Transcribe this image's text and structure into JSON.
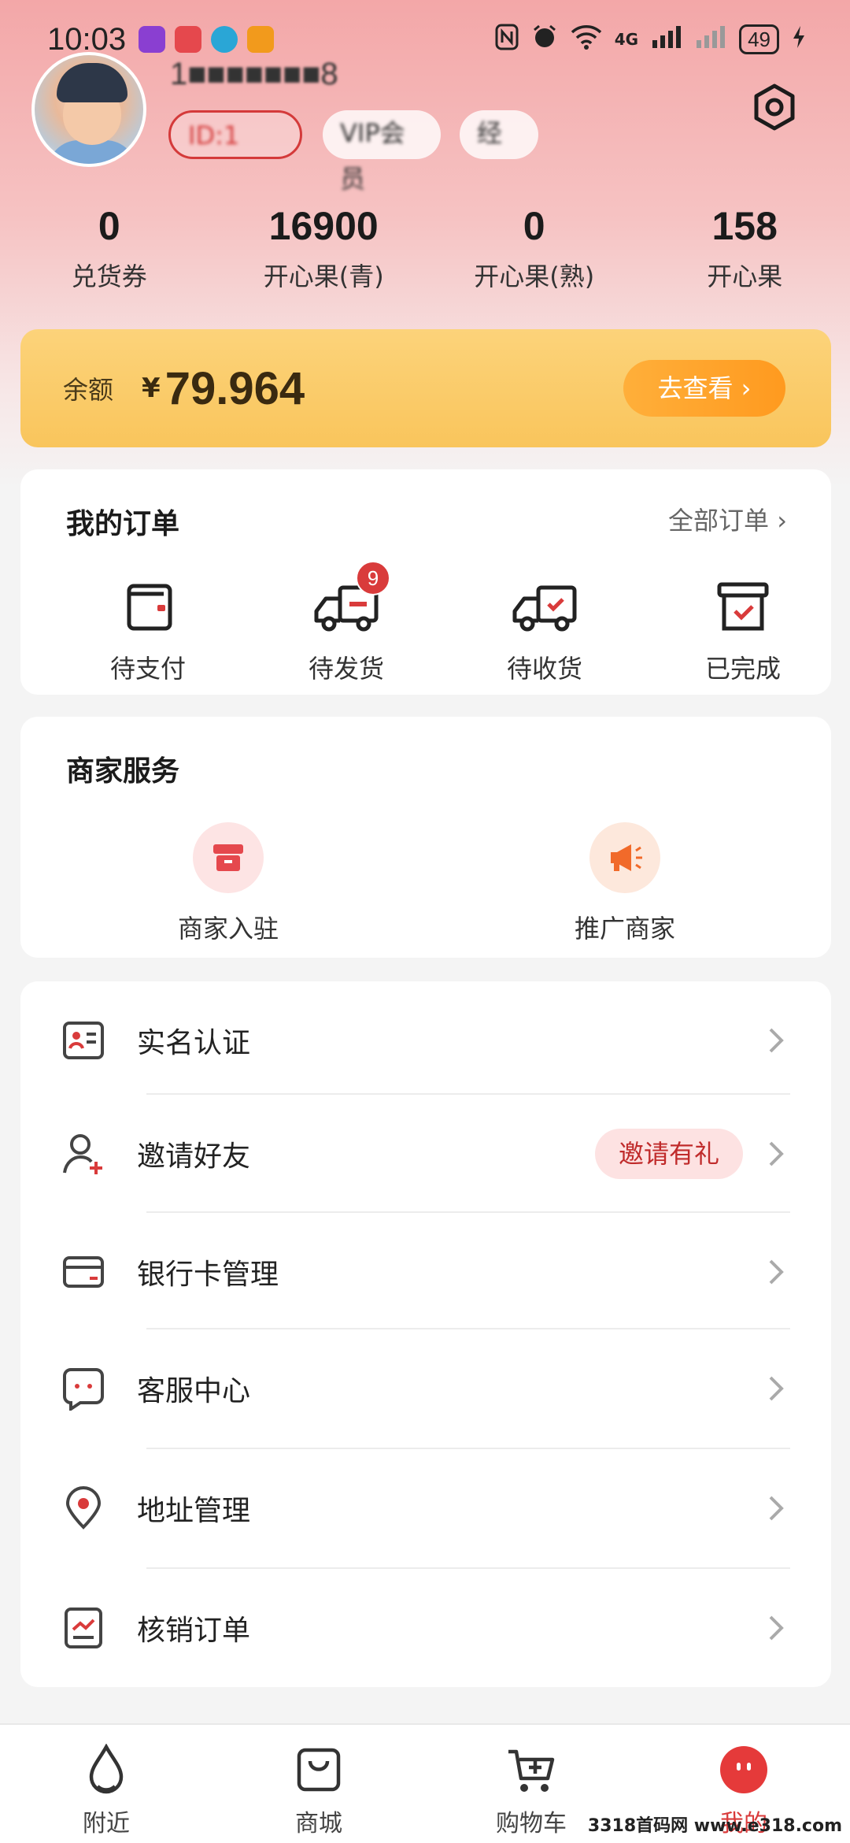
{
  "status_bar": {
    "time": "10:03",
    "network": "4G",
    "battery": "49"
  },
  "profile": {
    "username": "1■■■■■■■8",
    "id_prefix": "ID:1",
    "vip_label": "VIP会员",
    "level_label": "经"
  },
  "stats": [
    {
      "value": "0",
      "label": "兑货券"
    },
    {
      "value": "16900",
      "label": "开心果(青)"
    },
    {
      "value": "0",
      "label": "开心果(熟)"
    },
    {
      "value": "158",
      "label": "开心果"
    }
  ],
  "balance": {
    "label": "余额",
    "currency": "¥",
    "amount": "79.964",
    "button": "去查看 ›"
  },
  "orders": {
    "title": "我的订单",
    "all_link": "全部订单 ›",
    "items": [
      {
        "label": "待支付",
        "icon": "wallet-icon"
      },
      {
        "label": "待发货",
        "icon": "truck-pending-icon",
        "badge": "9"
      },
      {
        "label": "待收货",
        "icon": "truck-check-icon"
      },
      {
        "label": "已完成",
        "icon": "box-check-icon"
      }
    ]
  },
  "merchant": {
    "title": "商家服务",
    "items": [
      {
        "label": "商家入驻",
        "icon": "store-icon"
      },
      {
        "label": "推广商家",
        "icon": "megaphone-icon"
      }
    ]
  },
  "menu": [
    {
      "label": "实名认证",
      "icon": "id-card-icon"
    },
    {
      "label": "邀请好友",
      "icon": "add-user-icon",
      "tag": "邀请有礼"
    },
    {
      "label": "银行卡管理",
      "icon": "bank-card-icon"
    },
    {
      "label": "客服中心",
      "icon": "chat-icon"
    },
    {
      "label": "地址管理",
      "icon": "location-pin-icon"
    },
    {
      "label": "核销订单",
      "icon": "report-icon"
    }
  ],
  "tabbar": [
    {
      "label": "附近",
      "icon": "drop-icon"
    },
    {
      "label": "商城",
      "icon": "shopping-bag-icon"
    },
    {
      "label": "购物车",
      "icon": "cart-icon"
    },
    {
      "label": "我的",
      "icon": "profile-face-icon",
      "active": true
    }
  ],
  "watermark": "3318首码网 www.e318.com",
  "colors": {
    "accent": "#d93b3b",
    "balance_bg": "#f9c55c",
    "button_orange": "#ff9a1f",
    "tag_bg": "#fde2e2"
  }
}
